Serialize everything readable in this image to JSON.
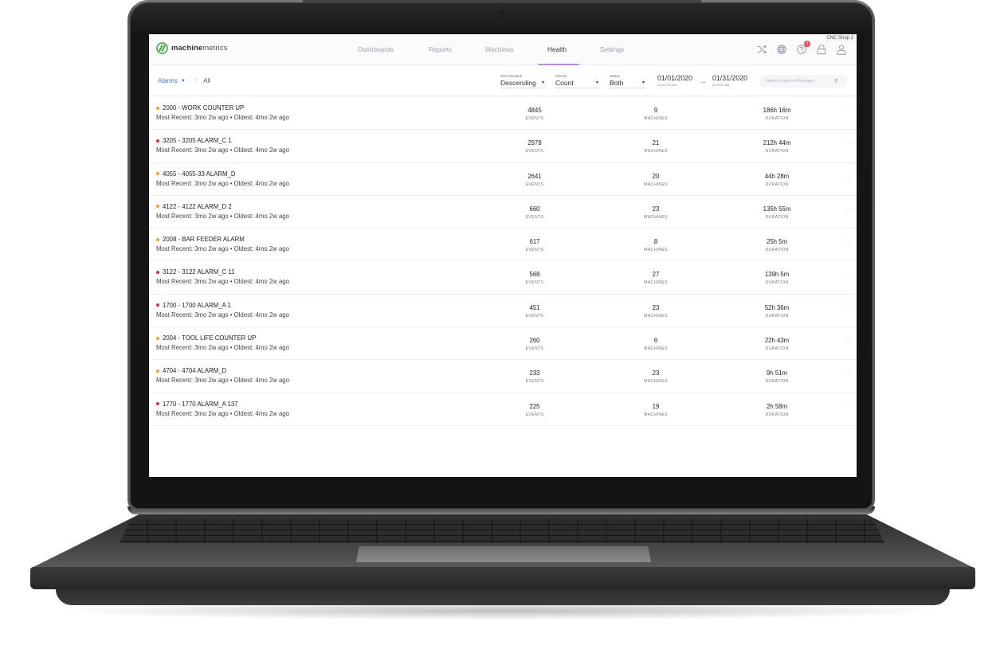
{
  "app": {
    "logo_bold": "machine",
    "logo_light": "metrics",
    "colors": {
      "accent": "#b38be0",
      "link": "#3a7bd5",
      "warning": "#f5a623",
      "critical": "#e8283c",
      "badge": "#e94d6b",
      "logo_green": "#3aa839"
    }
  },
  "nav": {
    "items": [
      {
        "label": "Dashboards",
        "active": false
      },
      {
        "label": "Reports",
        "active": false
      },
      {
        "label": "Machines",
        "active": false
      },
      {
        "label": "Health",
        "active": true
      },
      {
        "label": "Settings",
        "active": false
      }
    ]
  },
  "header_icons": {
    "shop_label": "CNC Shop 2",
    "notification_count": "1",
    "icons": [
      "shuffle-icon",
      "globe-icon",
      "help-icon",
      "lock-icon",
      "user-icon"
    ]
  },
  "filters": {
    "breadcrumb_root": "Alarms",
    "breadcrumb_current": "All",
    "sort_direction": {
      "label": "Sort Direction",
      "value": "Descending"
    },
    "sort_by": {
      "label": "Sort by",
      "value": "Count"
    },
    "status": {
      "label": "Status",
      "value": "Both"
    },
    "date_from": {
      "date": "01/01/2020",
      "time": "from 9:00 AM"
    },
    "date_to": {
      "date": "01/31/2020",
      "time": "to 10:00 AM"
    },
    "search_placeholder": "Native Code or Message"
  },
  "labels": {
    "events": "EVENTS",
    "machines": "MACHINES",
    "duration": "DURATION",
    "more": "···"
  },
  "alarms": [
    {
      "title": "2000 - WORK COUNTER UP",
      "severity": "warning",
      "subtitle": "Most Recent: 3mo 2w ago • Oldest: 4mo 2w ago",
      "events": "4845",
      "machines": "9",
      "duration": "186h 16m"
    },
    {
      "title": "3205 - 3205 ALARM_C 1",
      "severity": "critical",
      "subtitle": "Most Recent: 3mo 2w ago • Oldest: 4mo 2w ago",
      "events": "2978",
      "machines": "21",
      "duration": "212h 44m"
    },
    {
      "title": "4055 - 4055-33 ALARM_D",
      "severity": "warning",
      "subtitle": "Most Recent: 3mo 2w ago • Oldest: 4mo 2w ago",
      "events": "2641",
      "machines": "20",
      "duration": "44h 28m"
    },
    {
      "title": "4122 - 4122 ALARM_D 2",
      "severity": "warning",
      "subtitle": "Most Recent: 3mo 2w ago • Oldest: 4mo 2w ago",
      "events": "660",
      "machines": "23",
      "duration": "135h 55m"
    },
    {
      "title": "2008 - BAR FEEDER ALARM",
      "severity": "warning",
      "subtitle": "Most Recent: 3mo 2w ago • Oldest: 4mo 2w ago",
      "events": "617",
      "machines": "8",
      "duration": "25h 5m"
    },
    {
      "title": "3122 - 3122 ALARM_C 11",
      "severity": "critical",
      "subtitle": "Most Recent: 3mo 2w ago • Oldest: 4mo 2w ago",
      "events": "568",
      "machines": "27",
      "duration": "139h 5m"
    },
    {
      "title": "1700 - 1700 ALARM_A 1",
      "severity": "critical",
      "subtitle": "Most Recent: 3mo 2w ago • Oldest: 4mo 2w ago",
      "events": "451",
      "machines": "23",
      "duration": "52h 36m"
    },
    {
      "title": "2004 - TOOL LIFE COUNTER UP",
      "severity": "warning",
      "subtitle": "Most Recent: 3mo 2w ago • Oldest: 4mo 2w ago",
      "events": "260",
      "machines": "6",
      "duration": "22h 43m"
    },
    {
      "title": "4704 - 4704 ALARM_D",
      "severity": "warning",
      "subtitle": "Most Recent: 3mo 2w ago • Oldest: 4mo 2w ago",
      "events": "233",
      "machines": "23",
      "duration": "9h 51m"
    },
    {
      "title": "1770 - 1770 ALARM_A 137",
      "severity": "critical",
      "subtitle": "Most Recent: 3mo 2w ago • Oldest: 4mo 2w ago",
      "events": "225",
      "machines": "19",
      "duration": "2h 58m"
    }
  ]
}
